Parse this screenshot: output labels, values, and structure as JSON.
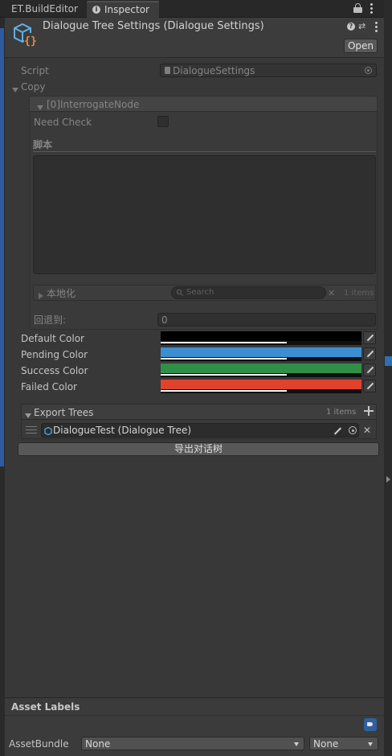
{
  "tabs": [
    {
      "label": "ET.BuildEditor"
    },
    {
      "label": "Inspector",
      "icon": "info-circle-icon"
    }
  ],
  "header": {
    "title": "Dialogue Tree Settings (Dialogue Settings)",
    "open_button": "Open"
  },
  "script_field": {
    "label": "Script",
    "value": "DialogueSettings"
  },
  "copy": {
    "label": "Copy",
    "node": {
      "title": "[0]InterrogateNode",
      "need_check_label": "Need Check",
      "script_section_label": "脚本",
      "localization": {
        "label": "本地化",
        "search_placeholder": "Search",
        "count": "1 items"
      },
      "fallback_label": "回退到:",
      "fallback_value": "0"
    }
  },
  "colors": [
    {
      "label": "Default Color",
      "hex": "#000000"
    },
    {
      "label": "Pending Color",
      "hex": "#3b8ed1"
    },
    {
      "label": "Success Color",
      "hex": "#2f8f46"
    },
    {
      "label": "Failed Color",
      "hex": "#e0422c"
    }
  ],
  "export_trees": {
    "label": "Export Trees",
    "count": "1 items",
    "items": [
      {
        "label": "DialogueTest (Dialogue Tree)"
      }
    ],
    "export_button": "导出对话树"
  },
  "asset_labels": {
    "title": "Asset Labels",
    "assetbundle_label": "AssetBundle",
    "bundle_value": "None",
    "variant_value": "None"
  }
}
